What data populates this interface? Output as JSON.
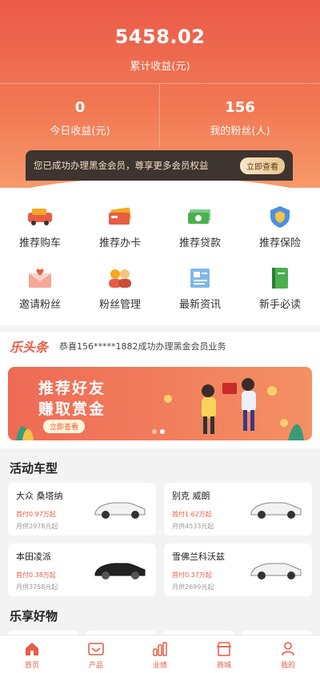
{
  "header": {
    "total_value": "5458.02",
    "total_label": "累计收益(元)",
    "today_value": "0",
    "today_label": "今日收益(元)",
    "fans_value": "156",
    "fans_label": "我的粉丝(人)",
    "vip_text": "您已成功办理黑金会员，尊享更多会员权益",
    "vip_button": "立即查看"
  },
  "menu": [
    {
      "label": "推荐购车",
      "icon": "car-icon"
    },
    {
      "label": "推荐办卡",
      "icon": "card-icon"
    },
    {
      "label": "推荐贷款",
      "icon": "money-icon"
    },
    {
      "label": "推荐保险",
      "icon": "shield-icon"
    },
    {
      "label": "邀请粉丝",
      "icon": "invite-envelope-icon"
    },
    {
      "label": "粉丝管理",
      "icon": "people-icon"
    },
    {
      "label": "最新资讯",
      "icon": "news-icon"
    },
    {
      "label": "新手必读",
      "icon": "book-icon"
    }
  ],
  "news": {
    "logo": "乐头条",
    "message": "恭喜156*****1882成功办理黑金会员业务"
  },
  "banner": {
    "line1": "推荐好友",
    "line2": "赚取赏金",
    "button": "立即查看"
  },
  "sections": {
    "cars_title": "活动车型",
    "goods_title": "乐享好物"
  },
  "cars": [
    {
      "name": "大众 桑塔纳",
      "down": "首付0.97万起",
      "month": "月供2978元起",
      "color": "#ffffff"
    },
    {
      "name": "别克 威朗",
      "down": "首付1.62万起",
      "month": "月供4533元起",
      "color": "#ffffff"
    },
    {
      "name": "本田凌派",
      "down": "首付0.38万起",
      "month": "月供3758元起",
      "color": "#222222"
    },
    {
      "name": "雪佛兰科沃兹",
      "down": "首付0.37万起",
      "month": "月供2699元起",
      "color": "#ffffff"
    }
  ],
  "tabbar": [
    {
      "label": "首页",
      "icon": "home-icon"
    },
    {
      "label": "产品",
      "icon": "product-icon"
    },
    {
      "label": "业绩",
      "icon": "chart-icon"
    },
    {
      "label": "商城",
      "icon": "store-icon"
    },
    {
      "label": "我的",
      "icon": "user-icon"
    }
  ],
  "colors": {
    "accent": "#e95c44",
    "gold": "#e9c58c",
    "dark": "#3e3430"
  }
}
